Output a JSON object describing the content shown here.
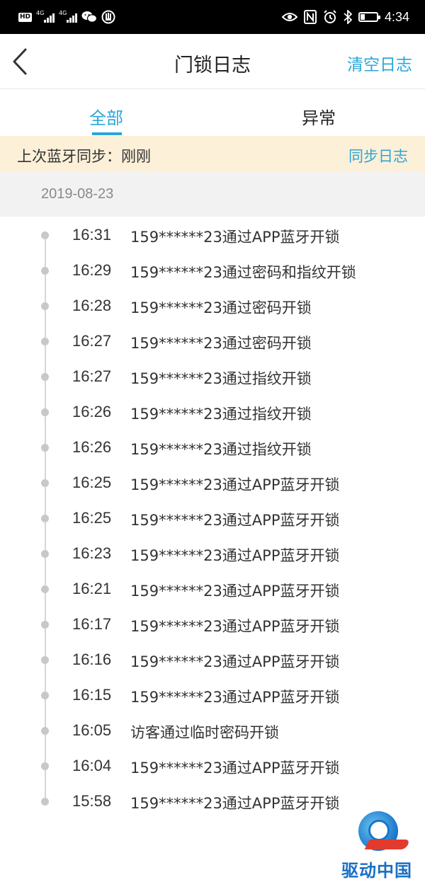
{
  "status_bar": {
    "badge": "HD",
    "network_1": "4G",
    "network_2": "4G",
    "time": "4:34",
    "battery_level": 0.25
  },
  "header": {
    "title": "门锁日志",
    "clear_label": "清空日志"
  },
  "tabs": [
    {
      "label": "全部",
      "active": true
    },
    {
      "label": "异常",
      "active": false
    }
  ],
  "sync": {
    "label": "上次蓝牙同步：刚刚",
    "button_label": "同步日志"
  },
  "date": "2019-08-23",
  "logs": [
    {
      "time": "16:31",
      "text": "159******23通过APP蓝牙开锁"
    },
    {
      "time": "16:29",
      "text": "159******23通过密码和指纹开锁"
    },
    {
      "time": "16:28",
      "text": "159******23通过密码开锁"
    },
    {
      "time": "16:27",
      "text": "159******23通过密码开锁"
    },
    {
      "time": "16:27",
      "text": "159******23通过指纹开锁"
    },
    {
      "time": "16:26",
      "text": "159******23通过指纹开锁"
    },
    {
      "time": "16:26",
      "text": "159******23通过指纹开锁"
    },
    {
      "time": "16:25",
      "text": "159******23通过APP蓝牙开锁"
    },
    {
      "time": "16:25",
      "text": "159******23通过APP蓝牙开锁"
    },
    {
      "time": "16:23",
      "text": "159******23通过APP蓝牙开锁"
    },
    {
      "time": "16:21",
      "text": "159******23通过APP蓝牙开锁"
    },
    {
      "time": "16:17",
      "text": "159******23通过APP蓝牙开锁"
    },
    {
      "time": "16:16",
      "text": "159******23通过APP蓝牙开锁"
    },
    {
      "time": "16:15",
      "text": "159******23通过APP蓝牙开锁"
    },
    {
      "time": "16:05",
      "text": "访客通过临时密码开锁"
    },
    {
      "time": "16:04",
      "text": "159******23通过APP蓝牙开锁"
    },
    {
      "time": "15:58",
      "text": "159******23通过APP蓝牙开锁"
    }
  ],
  "colors": {
    "accent": "#2aa6d8",
    "sync_bar": "#fdf0d9",
    "date_header": "#f2f2f2"
  },
  "icons": [
    "hd-badge-icon",
    "signal-icon",
    "wechat-icon",
    "shield-icon",
    "eye-icon",
    "nfc-icon",
    "alarm-icon",
    "bluetooth-icon",
    "battery-icon",
    "back-chevron-icon"
  ],
  "watermark": {
    "text": "驱动中国"
  }
}
